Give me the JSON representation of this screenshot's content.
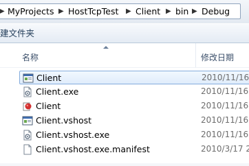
{
  "address_bar": {
    "crumbs": [
      "MyProjects",
      "HostTcpTest",
      "Client",
      "bin",
      "Debug"
    ],
    "separator": "▶"
  },
  "toolbar": {
    "new_folder_label": "建文件夹"
  },
  "columns": {
    "name": "名称",
    "date_modified": "修改日期"
  },
  "files": [
    {
      "name": "Client",
      "date": "2010/11/16",
      "icon": "console-app-icon",
      "selected": true
    },
    {
      "name": "Client.exe",
      "date": "2010/11/16",
      "icon": "config-file-icon",
      "selected": false
    },
    {
      "name": "Client",
      "date": "2010/11/16",
      "icon": "program-database-icon",
      "selected": false
    },
    {
      "name": "Client.vshost",
      "date": "2010/11/16",
      "icon": "console-app-icon",
      "selected": false
    },
    {
      "name": "Client.vshost.exe",
      "date": "2010/11/16",
      "icon": "config-file-icon",
      "selected": false
    },
    {
      "name": "Client.vshost.exe.manifest",
      "date": "2010/3/17 2",
      "icon": "text-file-icon",
      "selected": false
    }
  ]
}
